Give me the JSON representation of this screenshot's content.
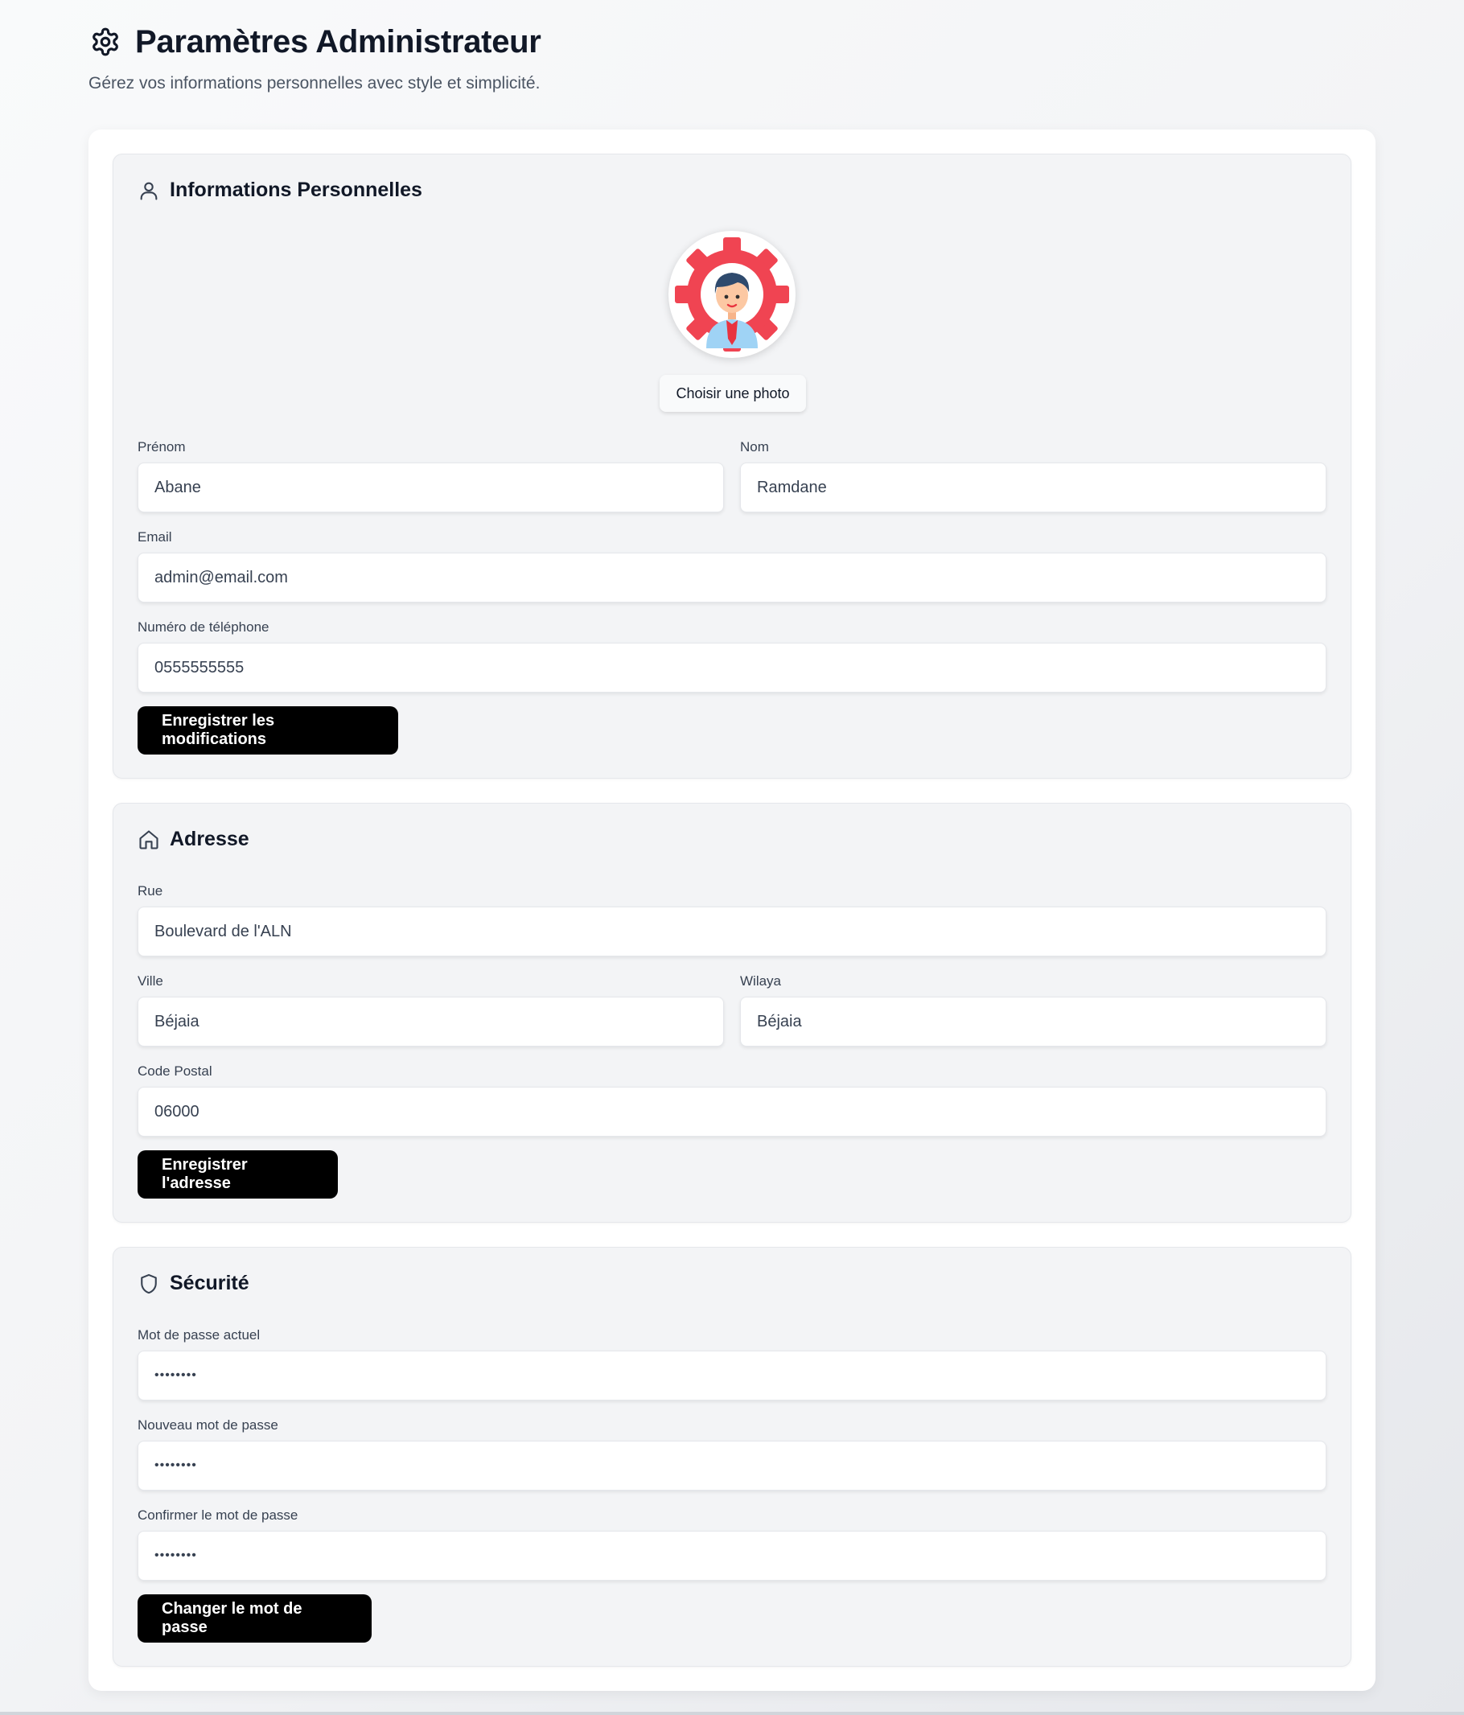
{
  "header": {
    "title": "Paramètres Administrateur",
    "subtitle": "Gérez vos informations personnelles avec style et simplicité.",
    "icon": "gear-icon"
  },
  "personal": {
    "title": "Informations Personnelles",
    "icon": "user-icon",
    "photo_button": "Choisir une photo",
    "first_name": {
      "label": "Prénom",
      "value": "Abane"
    },
    "last_name": {
      "label": "Nom",
      "value": "Ramdane"
    },
    "email": {
      "label": "Email",
      "value": "admin@email.com"
    },
    "phone": {
      "label": "Numéro de téléphone",
      "value": "0555555555"
    },
    "save_button": "Enregistrer les modifications"
  },
  "address": {
    "title": "Adresse",
    "icon": "home-icon",
    "street": {
      "label": "Rue",
      "value": "Boulevard de l'ALN"
    },
    "city": {
      "label": "Ville",
      "value": "Béjaia"
    },
    "wilaya": {
      "label": "Wilaya",
      "value": "Béjaia"
    },
    "postal": {
      "label": "Code Postal",
      "value": "06000"
    },
    "save_button": "Enregistrer l'adresse"
  },
  "security": {
    "title": "Sécurité",
    "icon": "shield-icon",
    "current": {
      "label": "Mot de passe actuel",
      "value": "••••••••"
    },
    "new": {
      "label": "Nouveau mot de passe",
      "value": "••••••••"
    },
    "confirm": {
      "label": "Confirmer le mot de passe",
      "value": "••••••••"
    },
    "save_button": "Changer le mot de passe"
  },
  "colors": {
    "button_bg": "#000000",
    "section_bg": "#f3f4f6",
    "avatar_gear": "#f04452"
  }
}
